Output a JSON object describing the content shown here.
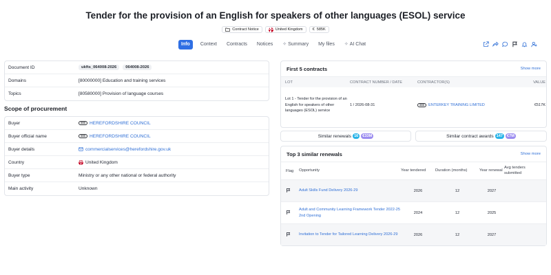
{
  "page": {
    "title": "Tender for the provision of an English for speakers of other languages (ESOL) service",
    "chips": {
      "notice": "Contract Notice",
      "country": "United Kingdom",
      "value": "585K"
    }
  },
  "tabs": [
    {
      "label": "Info",
      "active": true
    },
    {
      "label": "Context"
    },
    {
      "label": "Contracts"
    },
    {
      "label": "Notices"
    },
    {
      "label": "Summary"
    },
    {
      "label": "My files"
    },
    {
      "label": "AI Chat"
    }
  ],
  "toolbar_icons": [
    "export-icon",
    "share-icon",
    "comment-icon",
    "flag-icon",
    "bell-icon",
    "add-user-icon"
  ],
  "colors": {
    "accent": "#2f6fe4",
    "link": "#2f6fd6",
    "teal_badge": "#27b3e8",
    "purple_badge": "#9b8cf0"
  },
  "info": {
    "document_id": {
      "label": "Document ID",
      "values": [
        "ukfts_064008-2026",
        "064008-2026"
      ]
    },
    "domains": {
      "label": "Domains",
      "value": "[80000000] Education and training services"
    },
    "topics": {
      "label": "Topics",
      "value": "[80580000] Provision of language courses"
    }
  },
  "scope": {
    "heading": "Scope of procurement",
    "buyer": {
      "label": "Buyer",
      "badge": "999",
      "value": "HEREFORDSHIRE COUNCIL"
    },
    "buyer_official": {
      "label": "Buyer official name",
      "badge": "999",
      "value": "HEREFORDSHIRE COUNCIL"
    },
    "buyer_details": {
      "label": "Buyer details",
      "value": "commercialservices@herefordshire.gov.uk"
    },
    "country": {
      "label": "Country",
      "value": "United Kingdom"
    },
    "buyer_type": {
      "label": "Buyer type",
      "value": "Ministry or any other national or federal authority"
    },
    "main_activity": {
      "label": "Main activity",
      "value": "Unknown"
    }
  },
  "contracts": {
    "title": "First 5 contracts",
    "show_more": "Show more",
    "headers": {
      "lot": "LOT",
      "number_date": "CONTRACT NUMBER / DATE",
      "contractors": "CONTRACTOR(S)",
      "value": "VALUE"
    },
    "rows": [
      {
        "lot": "Lot 1 - Tender for the provision of an English for speakers of other languages (ESOL) service",
        "number_date": "1 / 2026-08-31",
        "badge": "999",
        "contractor": "ENTERKEY TRAINING LIMITED",
        "value": "€517K"
      }
    ]
  },
  "similar": {
    "renewals": {
      "label": "Similar renewals",
      "count": "16",
      "amount": "€33M"
    },
    "awards": {
      "label": "Similar contract awards",
      "count": "147",
      "amount": "€7M"
    }
  },
  "renewals": {
    "title": "Top 3 similar renewals",
    "show_more": "Show more",
    "headers": {
      "flag": "Flag",
      "opportunity": "Opportunity",
      "year_tendered": "Year tendered",
      "duration": "Duration (months)",
      "year_renewal": "Year renewal",
      "avg_tenders": "Avg tenders submitted"
    },
    "rows": [
      {
        "opportunity": "Adult Skills Fund Delivery 2026-29",
        "year_tendered": "2026",
        "duration": "12",
        "year_renewal": "2027"
      },
      {
        "opportunity": "Adult and Community Learning Framework Tender 2022-25 2nd Opening",
        "year_tendered": "2024",
        "duration": "12",
        "year_renewal": "2025"
      },
      {
        "opportunity": "Invitation to Tender for Tailored Learning Delivery 2026-29",
        "year_tendered": "2026",
        "duration": "12",
        "year_renewal": "2027"
      }
    ]
  }
}
